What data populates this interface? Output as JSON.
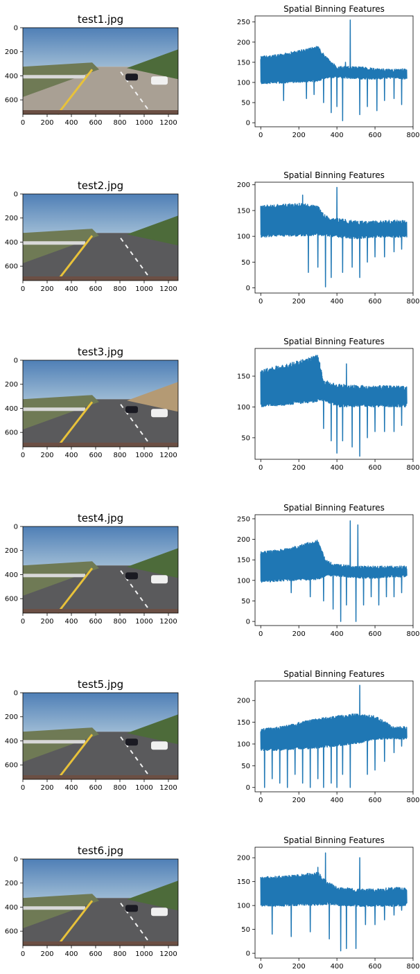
{
  "colors": {
    "line": "#1f77b4",
    "frame": "#000000"
  },
  "images": [
    {
      "title": "test1.jpg",
      "x_ticks": [
        "0",
        "200",
        "400",
        "600",
        "800",
        "1000",
        "1200"
      ],
      "y_ticks": [
        "0",
        "200",
        "400",
        "600"
      ]
    },
    {
      "title": "test2.jpg",
      "x_ticks": [
        "0",
        "200",
        "400",
        "600",
        "800",
        "1000",
        "1200"
      ],
      "y_ticks": [
        "0",
        "200",
        "400",
        "600"
      ]
    },
    {
      "title": "test3.jpg",
      "x_ticks": [
        "0",
        "200",
        "400",
        "600",
        "800",
        "1000",
        "1200"
      ],
      "y_ticks": [
        "0",
        "200",
        "400",
        "600"
      ]
    },
    {
      "title": "test4.jpg",
      "x_ticks": [
        "0",
        "200",
        "400",
        "600",
        "800",
        "1000",
        "1200"
      ],
      "y_ticks": [
        "0",
        "200",
        "400",
        "600"
      ]
    },
    {
      "title": "test5.jpg",
      "x_ticks": [
        "0",
        "200",
        "400",
        "600",
        "800",
        "1000",
        "1200"
      ],
      "y_ticks": [
        "0",
        "200",
        "400",
        "600"
      ]
    },
    {
      "title": "test6.jpg",
      "x_ticks": [
        "0",
        "200",
        "400",
        "600",
        "800",
        "1000",
        "1200"
      ],
      "y_ticks": [
        "0",
        "200",
        "400",
        "600"
      ]
    }
  ],
  "chart_data": [
    {
      "type": "line",
      "title": "Spatial Binning Features",
      "xlim": [
        -30,
        800
      ],
      "ylim": [
        -10,
        265
      ],
      "x_ticks": [
        0,
        200,
        400,
        600,
        800
      ],
      "y_ticks": [
        0,
        50,
        100,
        150,
        200,
        250
      ],
      "band": [
        [
          0,
          96,
          165
        ],
        [
          100,
          98,
          170
        ],
        [
          200,
          100,
          180
        ],
        [
          300,
          102,
          190
        ],
        [
          340,
          110,
          165
        ],
        [
          400,
          112,
          140
        ],
        [
          500,
          108,
          140
        ],
        [
          600,
          108,
          135
        ],
        [
          700,
          110,
          133
        ],
        [
          767,
          108,
          135
        ]
      ],
      "spikes": [
        [
          120,
          55
        ],
        [
          240,
          60
        ],
        [
          280,
          70
        ],
        [
          330,
          50
        ],
        [
          370,
          25
        ],
        [
          400,
          40
        ],
        [
          430,
          5
        ],
        [
          445,
          150
        ],
        [
          470,
          255
        ],
        [
          520,
          20
        ],
        [
          560,
          40
        ],
        [
          610,
          30
        ],
        [
          650,
          55
        ],
        [
          700,
          60
        ],
        [
          740,
          45
        ]
      ]
    },
    {
      "type": "line",
      "title": "Spatial Binning Features",
      "xlim": [
        -30,
        800
      ],
      "ylim": [
        -10,
        205
      ],
      "x_ticks": [
        0,
        200,
        400,
        600,
        800
      ],
      "y_ticks": [
        0,
        50,
        100,
        150,
        200
      ],
      "band": [
        [
          0,
          98,
          160
        ],
        [
          100,
          100,
          162
        ],
        [
          200,
          100,
          165
        ],
        [
          300,
          102,
          160
        ],
        [
          340,
          100,
          140
        ],
        [
          400,
          98,
          135
        ],
        [
          500,
          95,
          130
        ],
        [
          600,
          98,
          130
        ],
        [
          700,
          98,
          132
        ],
        [
          767,
          98,
          130
        ]
      ],
      "spikes": [
        [
          220,
          180
        ],
        [
          250,
          30
        ],
        [
          300,
          40
        ],
        [
          340,
          2
        ],
        [
          370,
          20
        ],
        [
          400,
          195
        ],
        [
          430,
          30
        ],
        [
          480,
          40
        ],
        [
          520,
          20
        ],
        [
          560,
          50
        ],
        [
          600,
          60
        ],
        [
          650,
          60
        ],
        [
          700,
          70
        ],
        [
          740,
          75
        ]
      ]
    },
    {
      "type": "line",
      "title": "Spatial Binning Features",
      "xlim": [
        -30,
        800
      ],
      "ylim": [
        15,
        195
      ],
      "x_ticks": [
        0,
        200,
        400,
        600,
        800
      ],
      "y_ticks": [
        50,
        100,
        150
      ],
      "band": [
        [
          0,
          100,
          160
        ],
        [
          100,
          102,
          168
        ],
        [
          200,
          105,
          175
        ],
        [
          300,
          108,
          185
        ],
        [
          330,
          110,
          145
        ],
        [
          400,
          100,
          138
        ],
        [
          500,
          100,
          135
        ],
        [
          600,
          100,
          135
        ],
        [
          700,
          100,
          135
        ],
        [
          767,
          100,
          135
        ]
      ],
      "spikes": [
        [
          330,
          65
        ],
        [
          370,
          45
        ],
        [
          400,
          25
        ],
        [
          430,
          45
        ],
        [
          450,
          170
        ],
        [
          480,
          35
        ],
        [
          520,
          20
        ],
        [
          560,
          50
        ],
        [
          600,
          60
        ],
        [
          650,
          60
        ],
        [
          700,
          60
        ],
        [
          740,
          70
        ]
      ]
    },
    {
      "type": "line",
      "title": "Spatial Binning Features",
      "xlim": [
        -30,
        800
      ],
      "ylim": [
        -10,
        260
      ],
      "x_ticks": [
        0,
        200,
        400,
        600,
        800
      ],
      "y_ticks": [
        0,
        50,
        100,
        150,
        200,
        250
      ],
      "band": [
        [
          0,
          95,
          170
        ],
        [
          100,
          98,
          175
        ],
        [
          200,
          100,
          185
        ],
        [
          300,
          102,
          200
        ],
        [
          340,
          110,
          150
        ],
        [
          400,
          110,
          140
        ],
        [
          500,
          105,
          135
        ],
        [
          600,
          105,
          135
        ],
        [
          700,
          108,
          135
        ],
        [
          767,
          108,
          135
        ]
      ],
      "spikes": [
        [
          160,
          70
        ],
        [
          260,
          60
        ],
        [
          330,
          50
        ],
        [
          380,
          30
        ],
        [
          420,
          0
        ],
        [
          450,
          40
        ],
        [
          470,
          245
        ],
        [
          500,
          0
        ],
        [
          510,
          235
        ],
        [
          540,
          40
        ],
        [
          580,
          60
        ],
        [
          620,
          40
        ],
        [
          660,
          60
        ],
        [
          700,
          60
        ],
        [
          740,
          70
        ]
      ]
    },
    {
      "type": "line",
      "title": "Spatial Binning Features",
      "xlim": [
        -30,
        800
      ],
      "ylim": [
        -10,
        245
      ],
      "x_ticks": [
        0,
        200,
        400,
        600,
        800
      ],
      "y_ticks": [
        0,
        50,
        100,
        150,
        200
      ],
      "band": [
        [
          0,
          85,
          135
        ],
        [
          100,
          85,
          140
        ],
        [
          200,
          88,
          150
        ],
        [
          300,
          90,
          160
        ],
        [
          400,
          95,
          165
        ],
        [
          500,
          100,
          170
        ],
        [
          600,
          110,
          165
        ],
        [
          700,
          112,
          140
        ],
        [
          767,
          110,
          140
        ]
      ],
      "spikes": [
        [
          20,
          0
        ],
        [
          60,
          20
        ],
        [
          100,
          10
        ],
        [
          140,
          0
        ],
        [
          180,
          30
        ],
        [
          220,
          10
        ],
        [
          260,
          0
        ],
        [
          300,
          20
        ],
        [
          330,
          0
        ],
        [
          370,
          10
        ],
        [
          400,
          0
        ],
        [
          430,
          30
        ],
        [
          470,
          0
        ],
        [
          520,
          235
        ],
        [
          560,
          30
        ],
        [
          600,
          40
        ],
        [
          650,
          60
        ],
        [
          700,
          80
        ],
        [
          740,
          95
        ]
      ]
    },
    {
      "type": "line",
      "title": "Spatial Binning Features",
      "xlim": [
        -30,
        800
      ],
      "ylim": [
        -10,
        222
      ],
      "x_ticks": [
        0,
        200,
        400,
        600,
        800
      ],
      "y_ticks": [
        0,
        50,
        100,
        150,
        200
      ],
      "band": [
        [
          0,
          98,
          160
        ],
        [
          100,
          98,
          162
        ],
        [
          200,
          100,
          165
        ],
        [
          300,
          100,
          170
        ],
        [
          350,
          102,
          150
        ],
        [
          400,
          100,
          140
        ],
        [
          500,
          98,
          135
        ],
        [
          600,
          98,
          135
        ],
        [
          700,
          98,
          138
        ],
        [
          767,
          100,
          138
        ]
      ],
      "spikes": [
        [
          60,
          40
        ],
        [
          160,
          35
        ],
        [
          260,
          45
        ],
        [
          300,
          180
        ],
        [
          340,
          210
        ],
        [
          360,
          30
        ],
        [
          420,
          5
        ],
        [
          450,
          10
        ],
        [
          500,
          10
        ],
        [
          520,
          200
        ],
        [
          550,
          60
        ],
        [
          600,
          60
        ],
        [
          650,
          70
        ],
        [
          700,
          80
        ],
        [
          740,
          90
        ]
      ]
    }
  ]
}
